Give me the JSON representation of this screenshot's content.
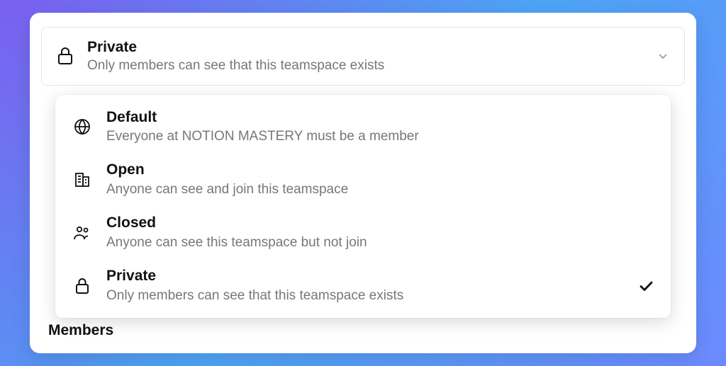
{
  "selected": {
    "title": "Private",
    "description": "Only members can see that this teamspace exists"
  },
  "options": [
    {
      "icon": "globe",
      "title": "Default",
      "description": "Everyone at NOTION MASTERY must be a member",
      "selected": false
    },
    {
      "icon": "building",
      "title": "Open",
      "description": "Anyone can see and join this teamspace",
      "selected": false
    },
    {
      "icon": "people",
      "title": "Closed",
      "description": "Anyone can see this teamspace but not join",
      "selected": false
    },
    {
      "icon": "lock",
      "title": "Private",
      "description": "Only members can see that this teamspace exists",
      "selected": true
    }
  ],
  "section_label": "Members"
}
